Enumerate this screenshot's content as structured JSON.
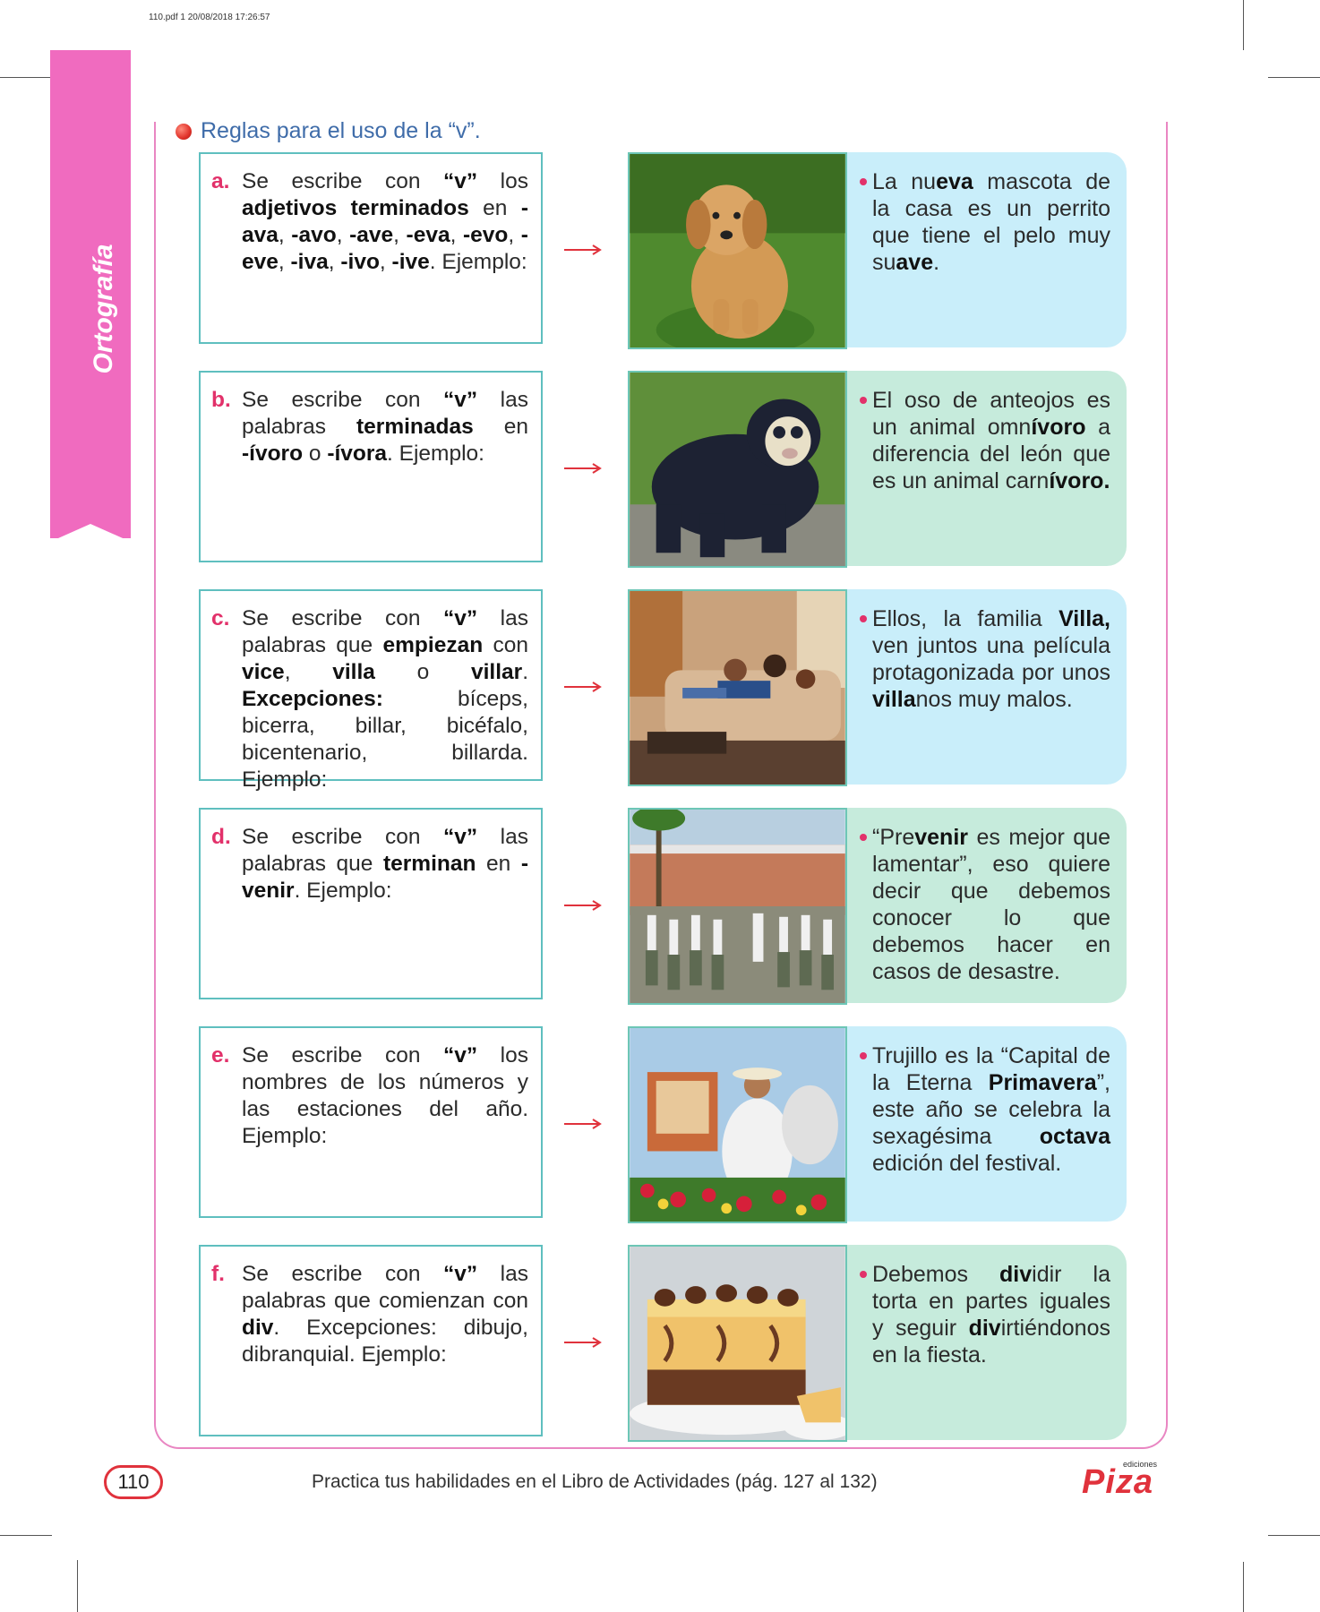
{
  "file_meta": "110.pdf   1   20/08/2018   17:26:57",
  "side_label": "Ortografía",
  "heading": "Reglas para el uso de la “v”.",
  "rules": [
    {
      "letter": "a.",
      "segments": [
        [
          "Se escribe con ",
          0
        ],
        [
          "“v”",
          1
        ],
        [
          " los ",
          0
        ],
        [
          "adjetivos terminados",
          1
        ],
        [
          " en ",
          0
        ],
        [
          "-ava",
          1
        ],
        [
          ", ",
          0
        ],
        [
          "-avo",
          1
        ],
        [
          ", ",
          0
        ],
        [
          "-ave",
          1
        ],
        [
          ", ",
          0
        ],
        [
          "-eva",
          1
        ],
        [
          ", ",
          0
        ],
        [
          "-evo",
          1
        ],
        [
          ", ",
          0
        ],
        [
          "-eve",
          1
        ],
        [
          ", ",
          0
        ],
        [
          "-iva",
          1
        ],
        [
          ", ",
          0
        ],
        [
          "-ivo",
          1
        ],
        [
          ", ",
          0
        ],
        [
          "-ive",
          1
        ],
        [
          ". Ejemplo:",
          0
        ]
      ],
      "example": [
        [
          "La nu",
          0
        ],
        [
          "eva",
          1
        ],
        [
          " mascota de la casa es un perrito que tiene el pelo muy su",
          0
        ],
        [
          "ave",
          1
        ],
        [
          ".",
          0
        ]
      ],
      "example_color": "blue",
      "photo": "puppy-photo"
    },
    {
      "letter": "b.",
      "segments": [
        [
          "Se escribe con ",
          0
        ],
        [
          "“v”",
          1
        ],
        [
          " las palabras ",
          0
        ],
        [
          "terminadas",
          1
        ],
        [
          " en ",
          0
        ],
        [
          "-ívoro",
          1
        ],
        [
          " o ",
          0
        ],
        [
          "-ívora",
          1
        ],
        [
          ". Ejemplo:",
          0
        ]
      ],
      "example": [
        [
          "El oso de anteojos es un animal omn",
          0
        ],
        [
          "ívoro",
          1
        ],
        [
          " a diferencia del león que es un animal carn",
          0
        ],
        [
          "ívoro.",
          1
        ]
      ],
      "example_color": "green",
      "photo": "bear-photo"
    },
    {
      "letter": "c.",
      "segments": [
        [
          "Se escribe con ",
          0
        ],
        [
          "“v”",
          1
        ],
        [
          " las palabras que ",
          0
        ],
        [
          "empiezan",
          1
        ],
        [
          " con ",
          0
        ],
        [
          "vice",
          1
        ],
        [
          ", ",
          0
        ],
        [
          "villa",
          1
        ],
        [
          " o ",
          0
        ],
        [
          "villar",
          1
        ],
        [
          ". ",
          0
        ],
        [
          "Excepciones:",
          1
        ],
        [
          " bíceps, bicerra, billar, bicéfalo, bicentenario, billarda. Ejemplo:",
          0
        ]
      ],
      "example": [
        [
          "Ellos, la familia ",
          0
        ],
        [
          "Villa,",
          1
        ],
        [
          " ven juntos una película protagonizada por unos ",
          0
        ],
        [
          "villa",
          1
        ],
        [
          "nos muy malos.",
          0
        ]
      ],
      "example_color": "blue",
      "photo": "family-photo"
    },
    {
      "letter": "d.",
      "segments": [
        [
          "Se escribe con ",
          0
        ],
        [
          "“v”",
          1
        ],
        [
          " las palabras que ",
          0
        ],
        [
          "terminan",
          1
        ],
        [
          " en ",
          0
        ],
        [
          "-venir",
          1
        ],
        [
          ". Ejemplo:",
          0
        ]
      ],
      "example": [
        [
          "“Pre",
          0
        ],
        [
          "venir",
          1
        ],
        [
          " es mejor que lamentar”, eso quiere decir que debemos conocer lo que debemos hacer en casos de desastre.",
          0
        ]
      ],
      "example_color": "green",
      "photo": "school-drill-photo"
    },
    {
      "letter": "e.",
      "segments": [
        [
          "Se escribe con ",
          0
        ],
        [
          "“v”",
          1
        ],
        [
          " los nombres de los números y las estaciones del año. Ejemplo:",
          0
        ]
      ],
      "example": [
        [
          "Trujillo es la “Capital de la Eterna ",
          0
        ],
        [
          "Primavera",
          1
        ],
        [
          "”, este año se celebra la sexagésima ",
          0
        ],
        [
          "octava",
          1
        ],
        [
          " edición del festival.",
          0
        ]
      ],
      "example_color": "blue",
      "photo": "festival-photo"
    },
    {
      "letter": "f.",
      "segments": [
        [
          "Se escribe con ",
          0
        ],
        [
          "“v”",
          1
        ],
        [
          " las palabras que comienzan con ",
          0
        ],
        [
          "div",
          1
        ],
        [
          ". Excepciones: dibujo, dibranquial. Ejemplo:",
          0
        ]
      ],
      "example": [
        [
          "Debemos ",
          0
        ],
        [
          "div",
          1
        ],
        [
          "idir la torta en partes iguales y seguir ",
          0
        ],
        [
          "div",
          1
        ],
        [
          "irtiéndonos en la fiesta.",
          0
        ]
      ],
      "example_color": "green",
      "photo": "cake-photo"
    }
  ],
  "page_number": "110",
  "footer": "Practica tus habilidades en el Libro de Actividades (pág. 127 al 132)",
  "logo": {
    "small": "ediciones",
    "main": "Piza"
  },
  "colors": {
    "accent_pink": "#f06bbf",
    "rule_letter": "#e2316a",
    "heading_blue": "#3f6ca9",
    "box_border": "#5fbfbf",
    "example_blue": "#c9eefa",
    "example_green": "#c6ebdc"
  }
}
